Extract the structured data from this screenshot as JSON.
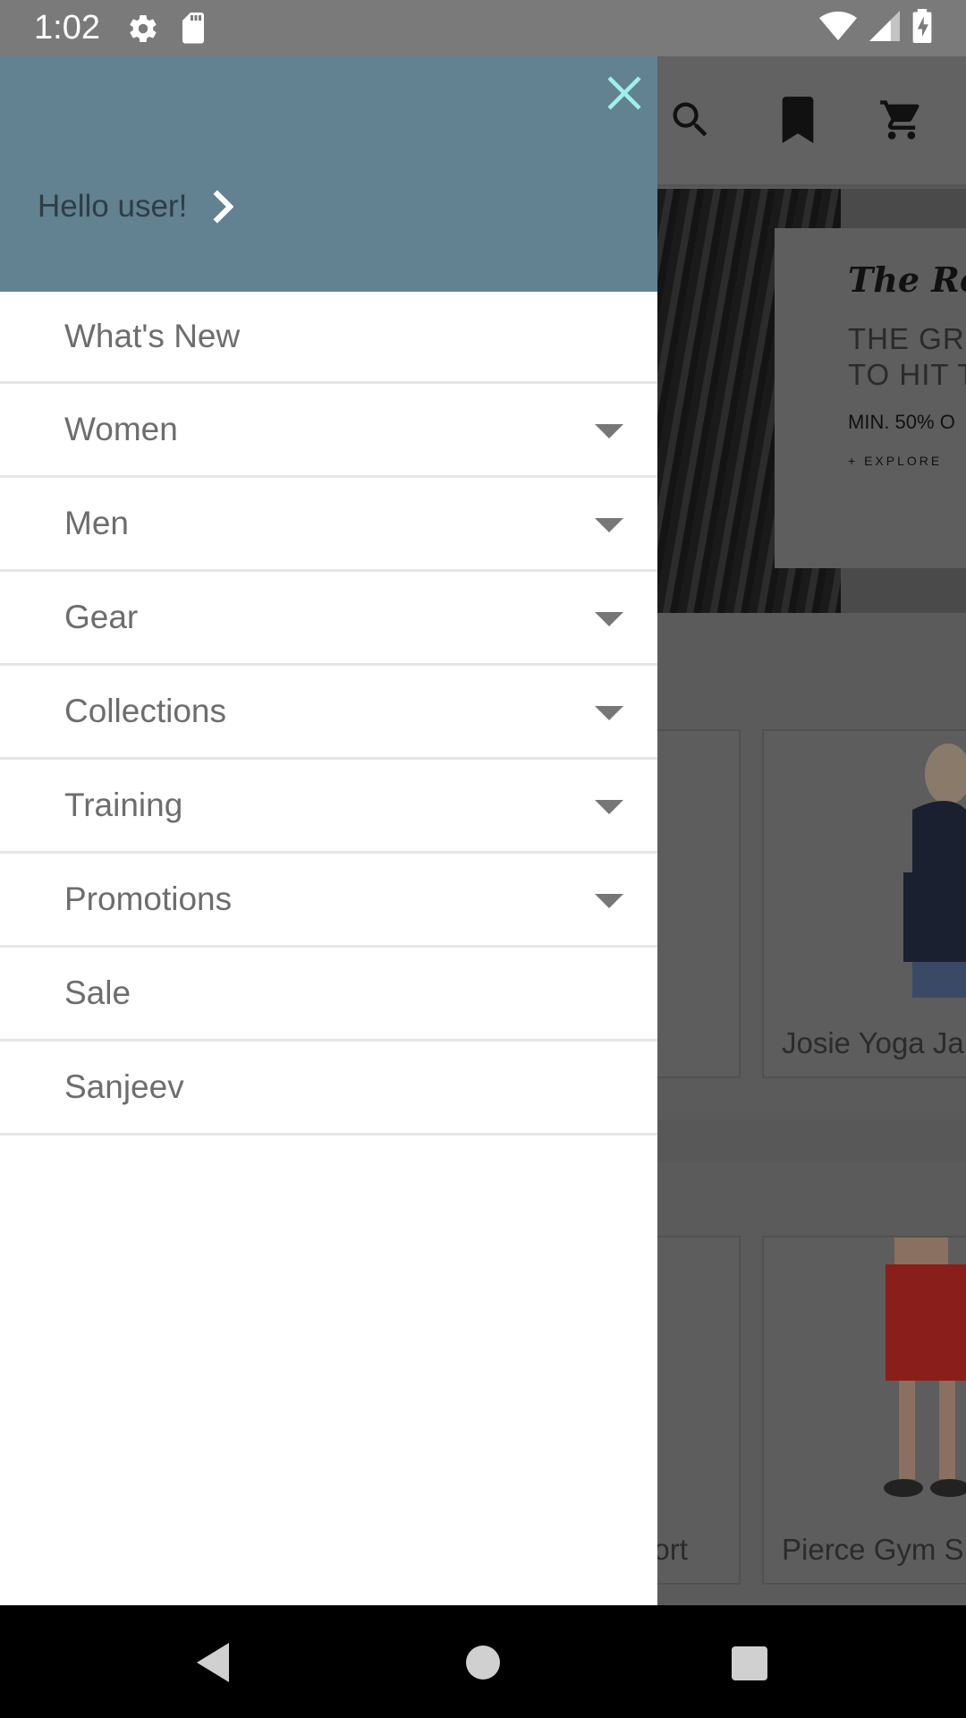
{
  "status_bar": {
    "time": "1:02",
    "icons": [
      "gear-icon",
      "sd-card-icon",
      "wifi-icon",
      "signal-icon",
      "battery-charging-icon"
    ]
  },
  "background_app": {
    "toolbar_icons": [
      "search-icon",
      "bookmark-icon",
      "cart-icon"
    ],
    "banner": {
      "logo_text": "The Roadster Life Co.",
      "headline_line1": "THE GRE",
      "headline_line2": "TO HIT T",
      "subtext": "MIN. 50% O",
      "explore": "+ EXPLORE"
    },
    "products": [
      {
        "name": "Josie Yoga Ja"
      },
      {
        "name": "hort"
      },
      {
        "name": "Pierce Gym S"
      }
    ]
  },
  "drawer": {
    "greeting": "Hello user!",
    "menu": [
      {
        "label": "What's New",
        "expandable": false
      },
      {
        "label": "Women",
        "expandable": true
      },
      {
        "label": "Men",
        "expandable": true
      },
      {
        "label": "Gear",
        "expandable": true
      },
      {
        "label": "Collections",
        "expandable": true
      },
      {
        "label": "Training",
        "expandable": true
      },
      {
        "label": "Promotions",
        "expandable": true
      },
      {
        "label": "Sale",
        "expandable": false
      },
      {
        "label": "Sanjeev",
        "expandable": false
      }
    ],
    "colors": {
      "header_bg": "#628191",
      "close_icon": "#9ff0ea",
      "label": "#6d6d6d"
    }
  },
  "nav_bar": {
    "buttons": [
      "back-icon",
      "home-icon",
      "recents-icon"
    ]
  }
}
